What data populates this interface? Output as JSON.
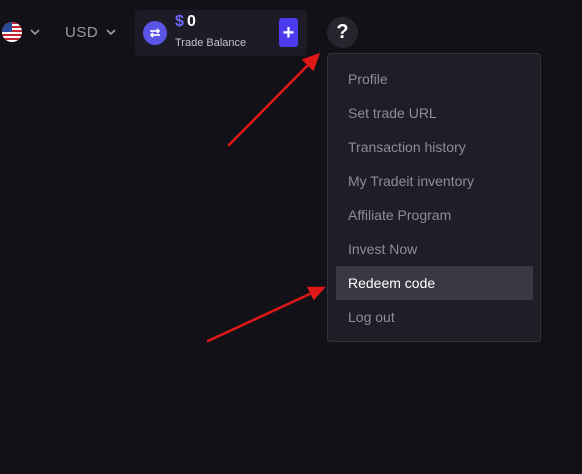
{
  "header": {
    "language_flag": "us-flag-icon",
    "currency": "USD",
    "balance": {
      "currency_symbol": "$",
      "amount": "0",
      "label": "Trade Balance",
      "add_label": "+"
    },
    "help_label": "?"
  },
  "account_menu": {
    "items": [
      {
        "label": "Profile"
      },
      {
        "label": "Set trade URL"
      },
      {
        "label": "Transaction history"
      },
      {
        "label": "My Tradeit inventory"
      },
      {
        "label": "Affiliate Program"
      },
      {
        "label": "Invest Now"
      },
      {
        "label": "Redeem code",
        "highlighted": true
      },
      {
        "label": "Log out"
      }
    ]
  },
  "colors": {
    "background": "#121118",
    "accent": "#4b3cf0",
    "annotation_arrow": "#e01818"
  }
}
